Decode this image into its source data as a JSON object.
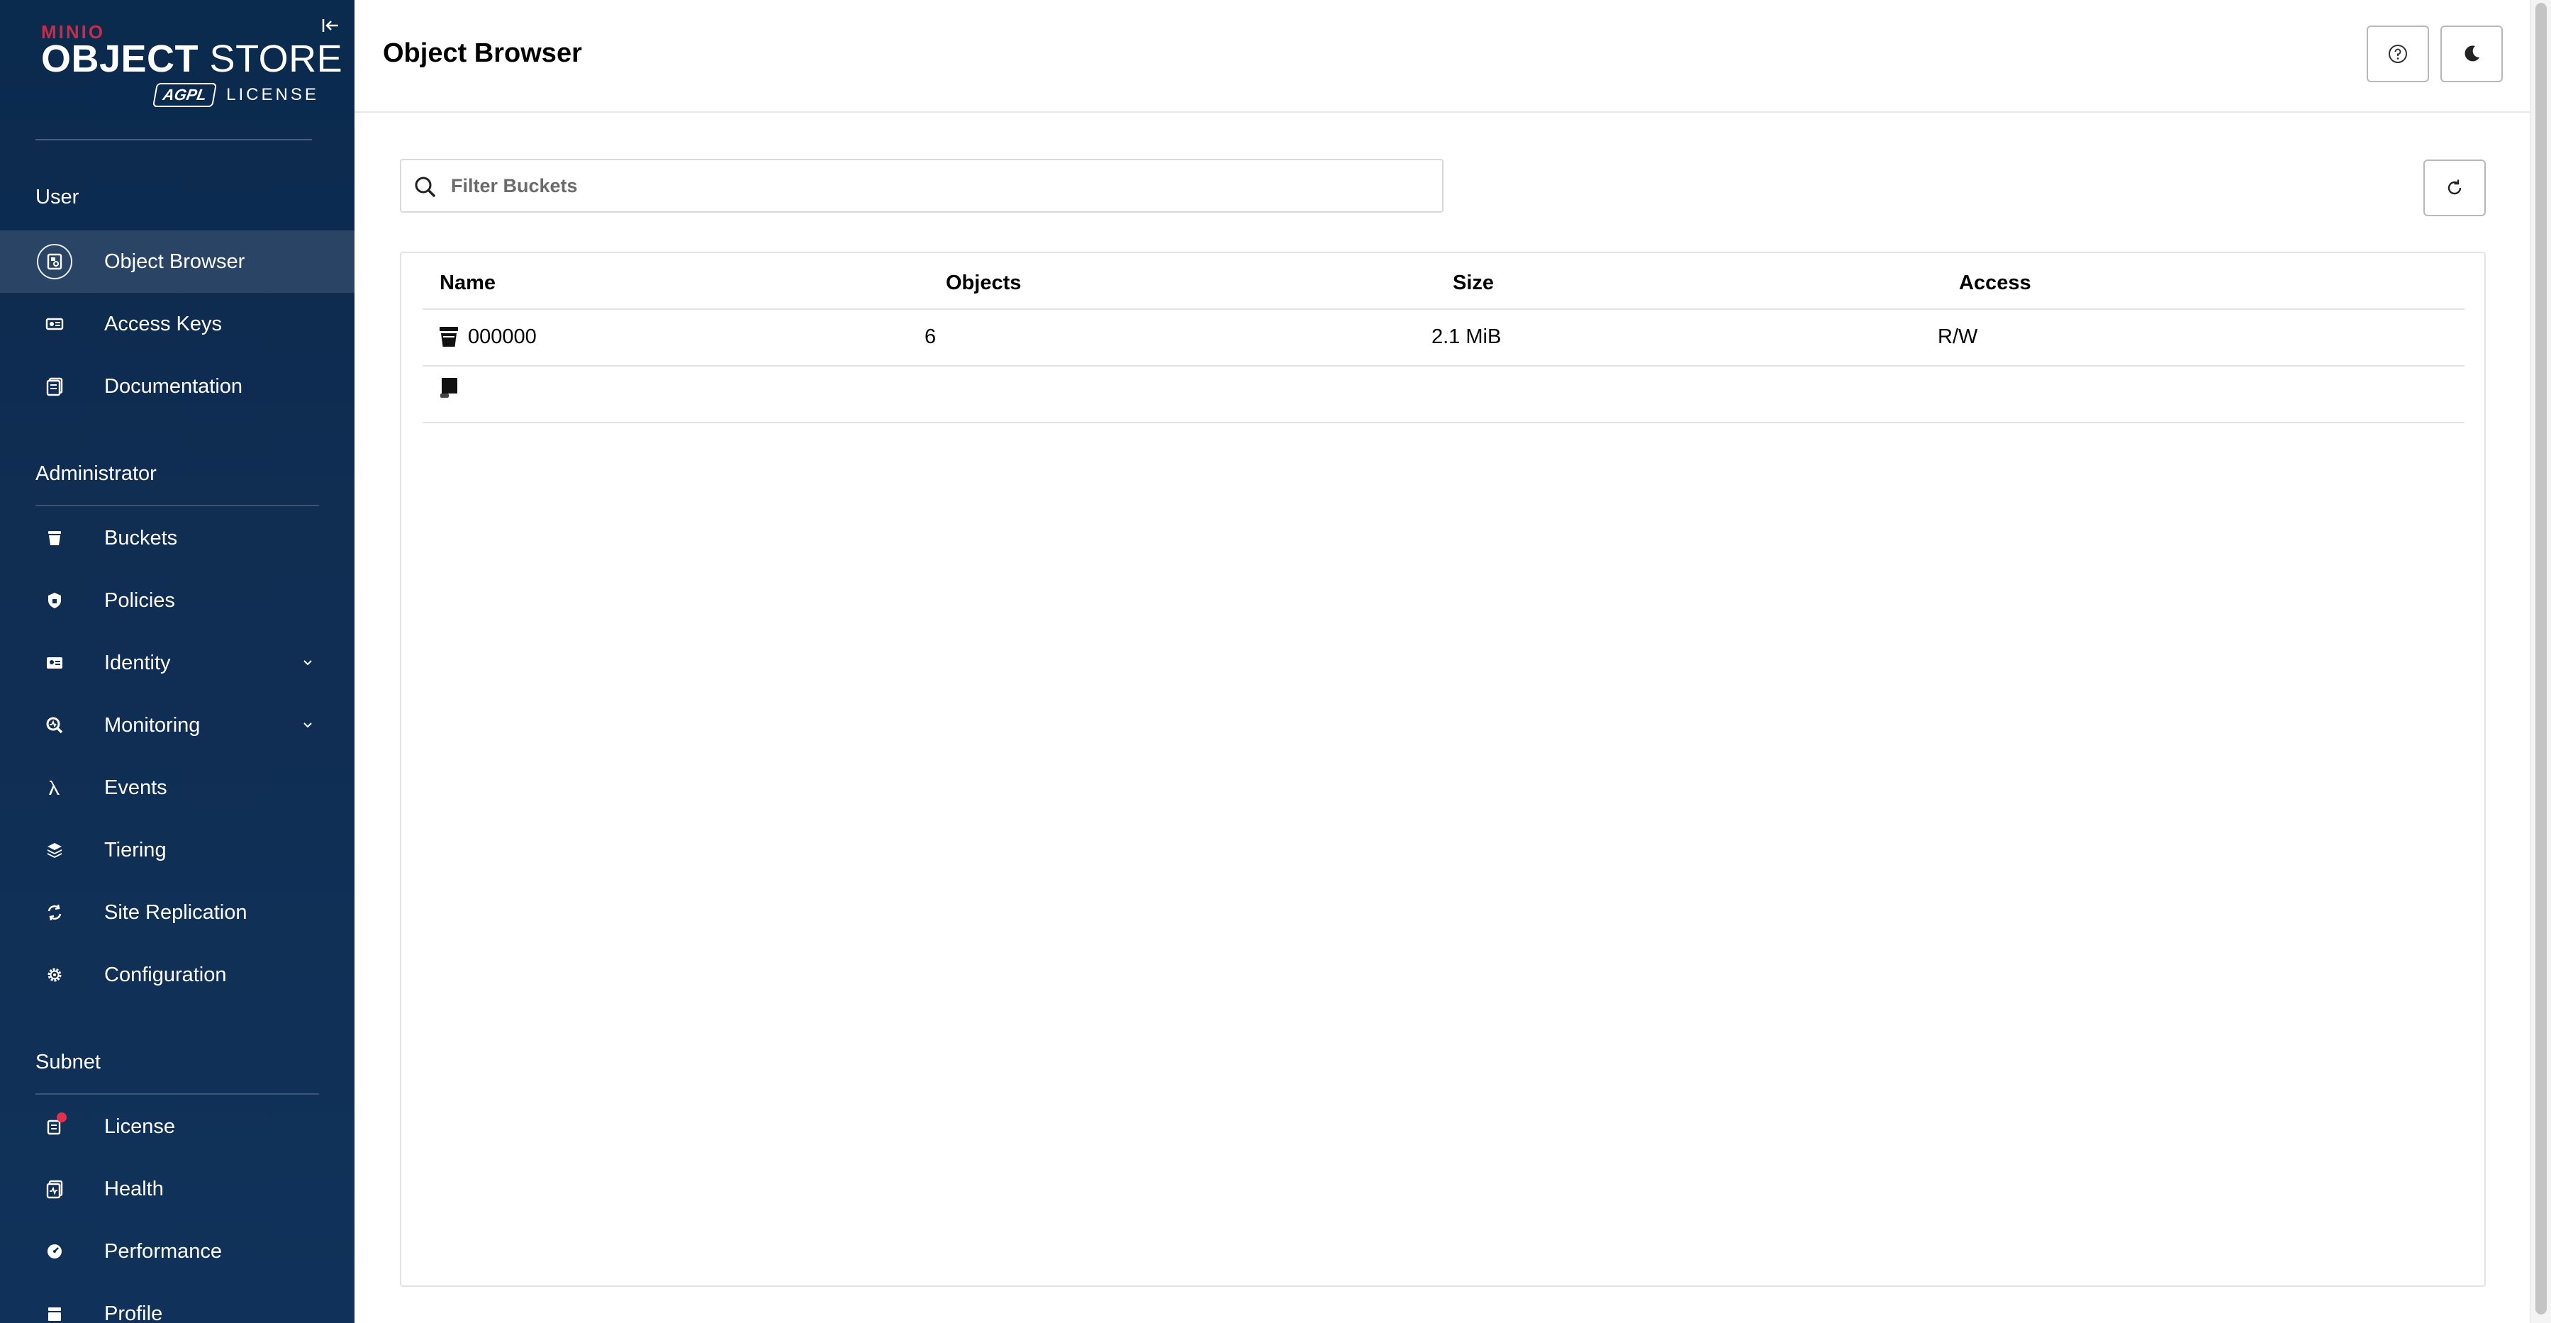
{
  "brand": {
    "vendor": "MINIO",
    "title_bold": "OBJECT",
    "title_light": " STORE",
    "badge": "AGPL",
    "license": "LICENSE"
  },
  "sidebar": {
    "sections": [
      {
        "label": "User",
        "items": [
          {
            "label": "Object Browser",
            "icon": "object-browser-icon",
            "active": true
          },
          {
            "label": "Access Keys",
            "icon": "access-keys-icon"
          },
          {
            "label": "Documentation",
            "icon": "documentation-icon"
          }
        ]
      },
      {
        "label": "Administrator",
        "items": [
          {
            "label": "Buckets",
            "icon": "bucket-icon"
          },
          {
            "label": "Policies",
            "icon": "shield-icon"
          },
          {
            "label": "Identity",
            "icon": "identity-icon",
            "expandable": true
          },
          {
            "label": "Monitoring",
            "icon": "monitoring-icon",
            "expandable": true
          },
          {
            "label": "Events",
            "icon": "lambda-icon"
          },
          {
            "label": "Tiering",
            "icon": "tiering-icon"
          },
          {
            "label": "Site Replication",
            "icon": "replication-icon"
          },
          {
            "label": "Configuration",
            "icon": "gear-icon"
          }
        ]
      },
      {
        "label": "Subnet",
        "items": [
          {
            "label": "License",
            "icon": "license-icon",
            "badge": true
          },
          {
            "label": "Health",
            "icon": "health-icon"
          },
          {
            "label": "Performance",
            "icon": "performance-icon"
          },
          {
            "label": "Profile",
            "icon": "profile-icon"
          }
        ]
      }
    ]
  },
  "header": {
    "title": "Object Browser",
    "help_icon": "help-icon",
    "theme_icon": "moon-icon"
  },
  "search": {
    "placeholder": "Filter Buckets",
    "value": ""
  },
  "refresh_icon": "refresh-icon",
  "table": {
    "columns": [
      "Name",
      "Objects",
      "Size",
      "Access"
    ],
    "rows": [
      {
        "name": "000000",
        "objects": "6",
        "size": "2.1 MiB",
        "access": "R/W"
      },
      {
        "name": "",
        "objects": "",
        "size": "",
        "access": ""
      }
    ]
  },
  "colors": {
    "sidebar_bg": "#0a2a4e",
    "brand_accent": "#c72c48",
    "notify_dot": "#e0304a"
  }
}
